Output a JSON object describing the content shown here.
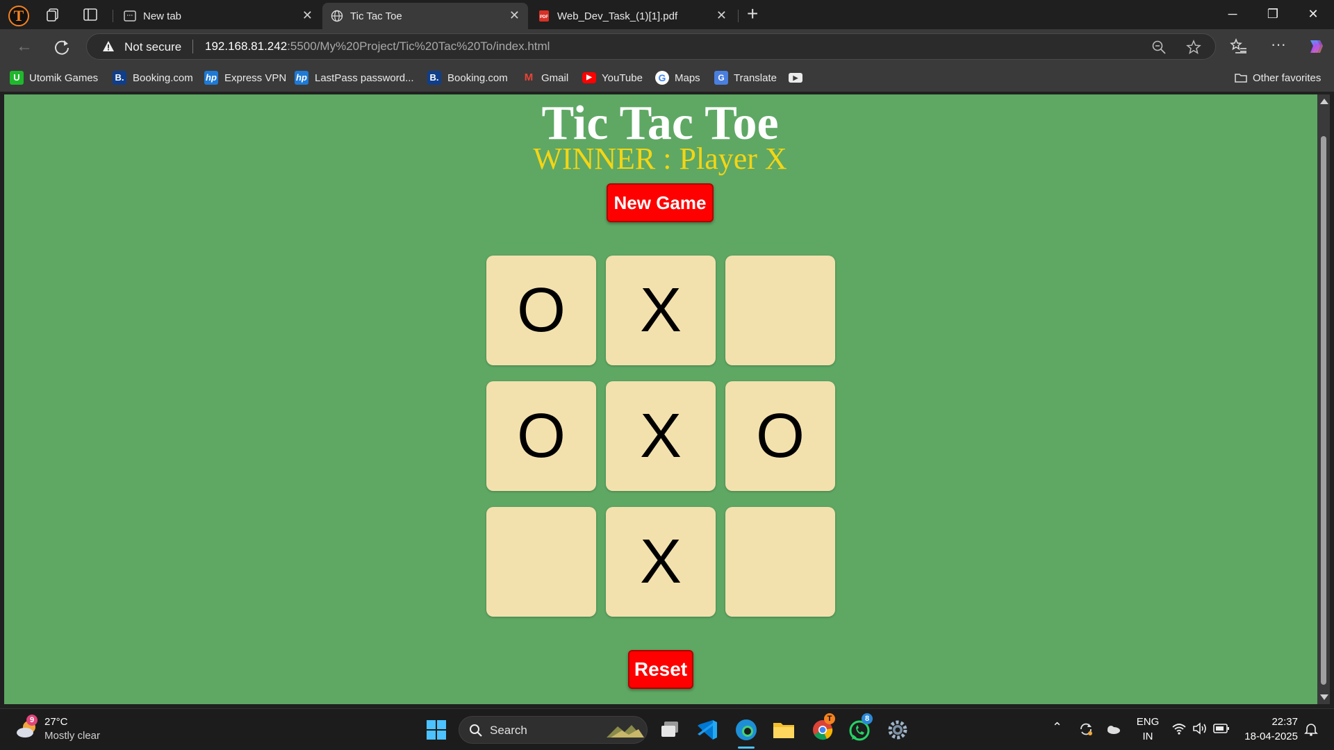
{
  "browser": {
    "profile_letter": "T",
    "tabs": [
      {
        "title": "New tab"
      },
      {
        "title": "Tic Tac Toe"
      },
      {
        "title": "Web_Dev_Task_(1)[1].pdf"
      }
    ],
    "address": {
      "security_label": "Not secure",
      "url_host": "192.168.81.242",
      "url_path": ":5500/My%20Project/Tic%20Tac%20To/index.html"
    },
    "bookmarks": [
      {
        "label": "Utomik Games",
        "icon": "utomik-icon",
        "color": "#1fb82c",
        "glyph": "U"
      },
      {
        "label": "Booking.com",
        "icon": "booking-icon",
        "color": "#0f3e8a",
        "glyph": "B."
      },
      {
        "label": "Express VPN",
        "icon": "hp-icon",
        "color": "#1e7ad6",
        "glyph": "hp"
      },
      {
        "label": "LastPass password...",
        "icon": "hp-icon",
        "color": "#1e7ad6",
        "glyph": "hp"
      },
      {
        "label": "Booking.com",
        "icon": "booking-icon",
        "color": "#0f3e8a",
        "glyph": "B."
      },
      {
        "label": "Gmail",
        "icon": "gmail-icon",
        "color": "#ea4335",
        "glyph": "M"
      },
      {
        "label": "YouTube",
        "icon": "youtube-icon",
        "color": "#ff0000",
        "glyph": "▶"
      },
      {
        "label": "Maps",
        "icon": "google-icon",
        "color": "#ffffff",
        "glyph": "G"
      },
      {
        "label": "Translate",
        "icon": "translate-icon",
        "color": "#4a7fe0",
        "glyph": "G"
      }
    ],
    "other_favorites": "Other favorites"
  },
  "game": {
    "title": "Tic Tac Toe",
    "status": "WINNER : Player X",
    "new_game_label": "New Game",
    "reset_label": "Reset",
    "board": [
      "O",
      "X",
      "",
      "O",
      "X",
      "O",
      "",
      "X",
      ""
    ],
    "colors": {
      "background": "#5ea864",
      "cell": "#f3e1ad",
      "status_text": "#f5d514",
      "button": "#ff0000"
    }
  },
  "taskbar": {
    "weather_temp": "27°C",
    "weather_condition": "Mostly clear",
    "weather_badge": "9",
    "search_label": "Search",
    "whatsapp_badge": "8",
    "language_line1": "ENG",
    "language_line2": "IN",
    "time": "22:37",
    "date": "18-04-2025"
  }
}
